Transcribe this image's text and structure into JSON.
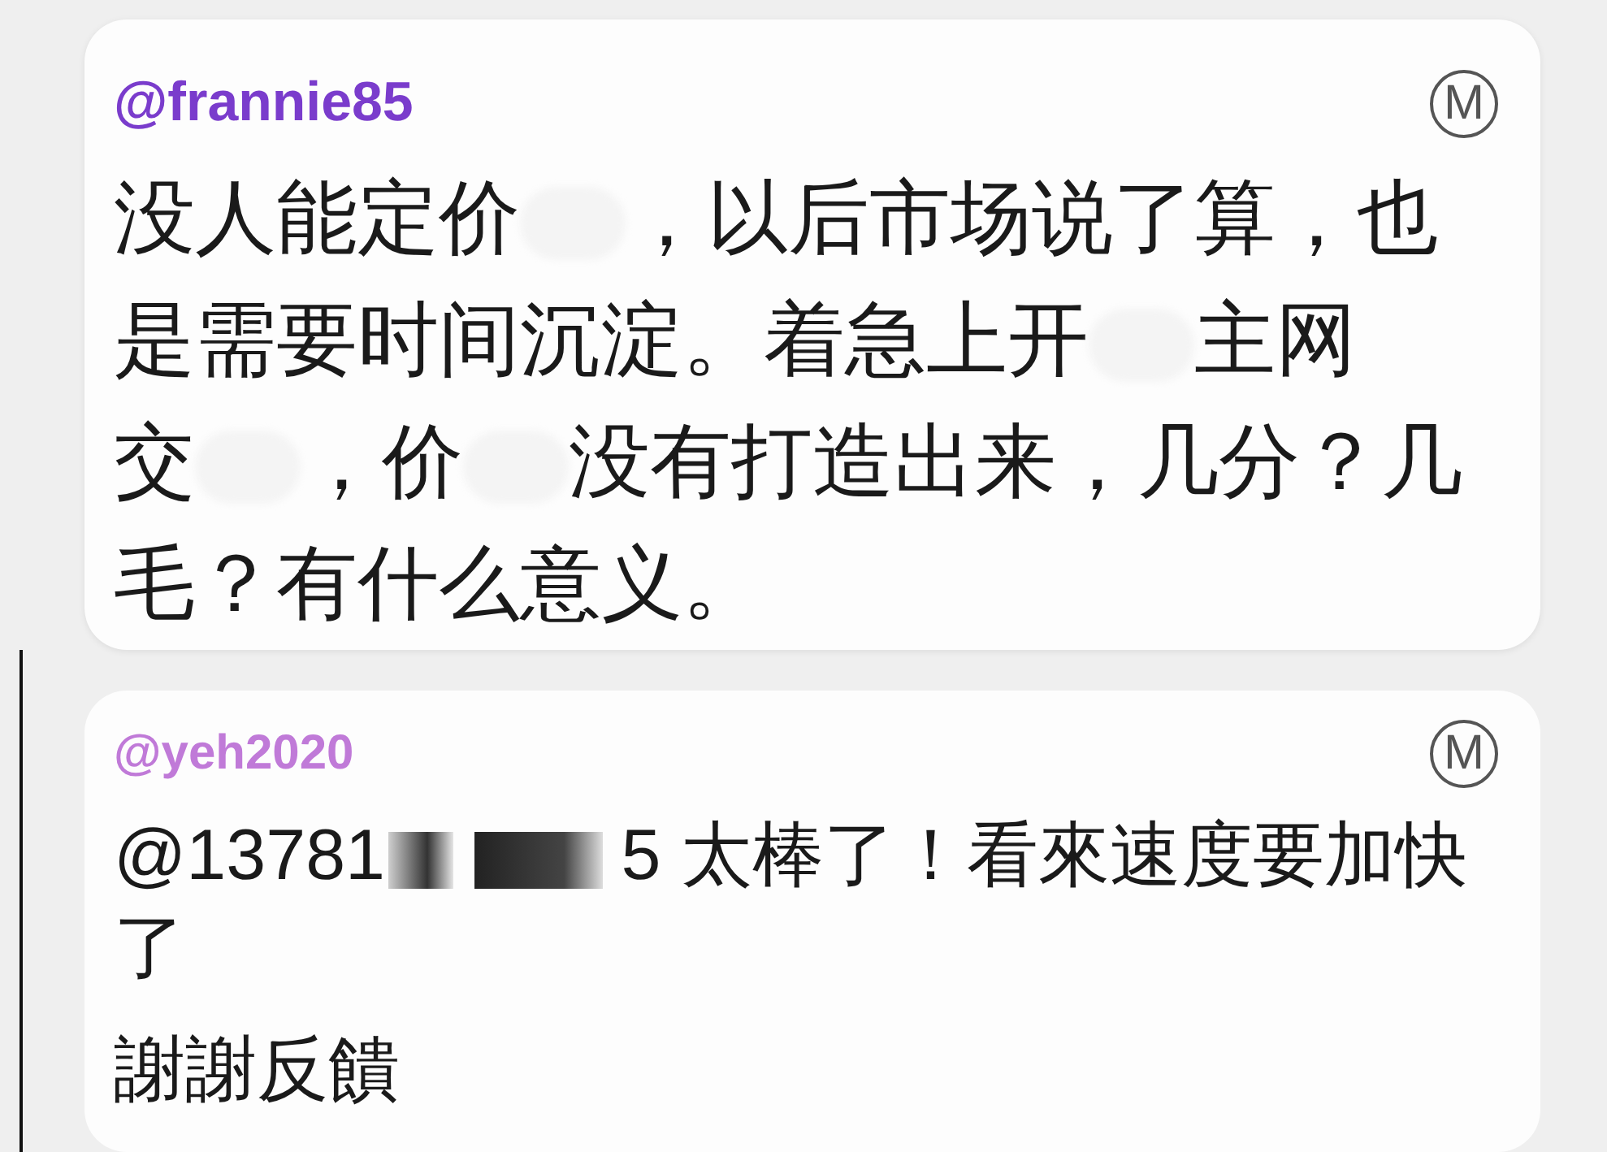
{
  "comments": [
    {
      "username": "@frannie85",
      "badge": "M",
      "kind": "post",
      "paragraphs": [
        {
          "lines": [
            [
              {
                "kind": "text",
                "text": "没人能定价"
              },
              {
                "kind": "blur"
              },
              {
                "kind": "text",
                "text": "，以后市场说了算，也"
              }
            ],
            [
              {
                "kind": "text",
                "text": "是需要时间沉淀。着急上开"
              },
              {
                "kind": "blur"
              },
              {
                "kind": "text",
                "text": "主网"
              }
            ],
            [
              {
                "kind": "text",
                "text": "交"
              },
              {
                "kind": "blur"
              },
              {
                "kind": "text",
                "text": "，价"
              },
              {
                "kind": "blur"
              },
              {
                "kind": "text",
                "text": "没有打造出来，几分？几"
              }
            ],
            [
              {
                "kind": "text",
                "text": "毛？有什么意义。"
              }
            ]
          ]
        }
      ]
    },
    {
      "username": "@yeh2020",
      "badge": "M",
      "kind": "reply",
      "paragraphs": [
        {
          "lines": [
            [
              {
                "kind": "text",
                "text": "@13781"
              },
              {
                "kind": "redaction"
              },
              {
                "kind": "text",
                "text": "5 太棒了！看來速度要加快"
              }
            ],
            [
              {
                "kind": "text",
                "text": "了"
              }
            ]
          ]
        },
        {
          "lines": [
            [
              {
                "kind": "text",
                "text": "謝謝反饋"
              }
            ]
          ]
        }
      ]
    }
  ]
}
